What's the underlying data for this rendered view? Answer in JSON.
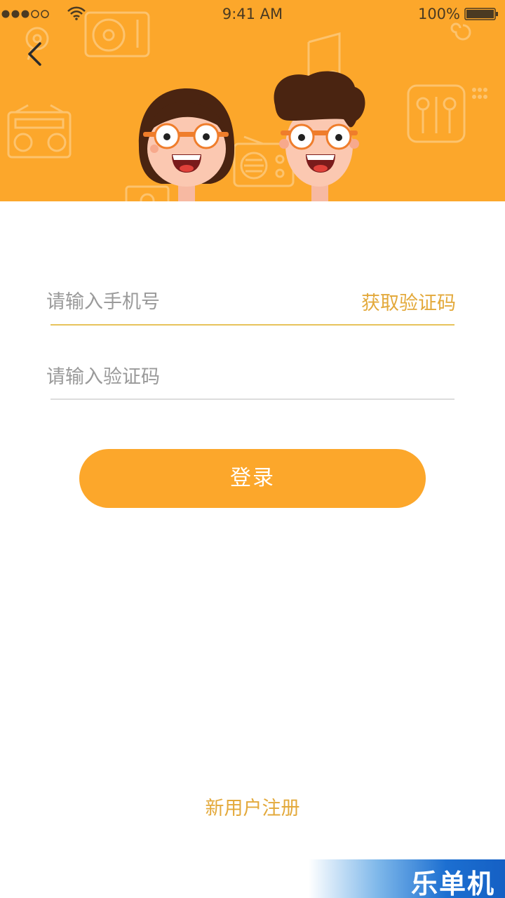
{
  "status_bar": {
    "time": "9:41 AM",
    "battery": "100%",
    "signal_icon": "signal-dots-icon",
    "wifi_icon": "wifi-icon",
    "battery_icon": "battery-icon"
  },
  "header": {
    "back_icon": "back-arrow-icon",
    "illustration": "two-cartoon-characters-with-music-devices",
    "background_color": "#fca72b"
  },
  "form": {
    "phone_placeholder": "请输入手机号",
    "get_code_label": "获取验证码",
    "code_placeholder": "请输入验证码",
    "login_label": "登录"
  },
  "footer": {
    "register_label": "新用户注册"
  },
  "watermark": {
    "text": "乐单机"
  },
  "colors": {
    "accent": "#fca72b",
    "link": "#e3a93b",
    "active_underline": "#e7c35c",
    "inactive_underline": "#dddddd"
  }
}
